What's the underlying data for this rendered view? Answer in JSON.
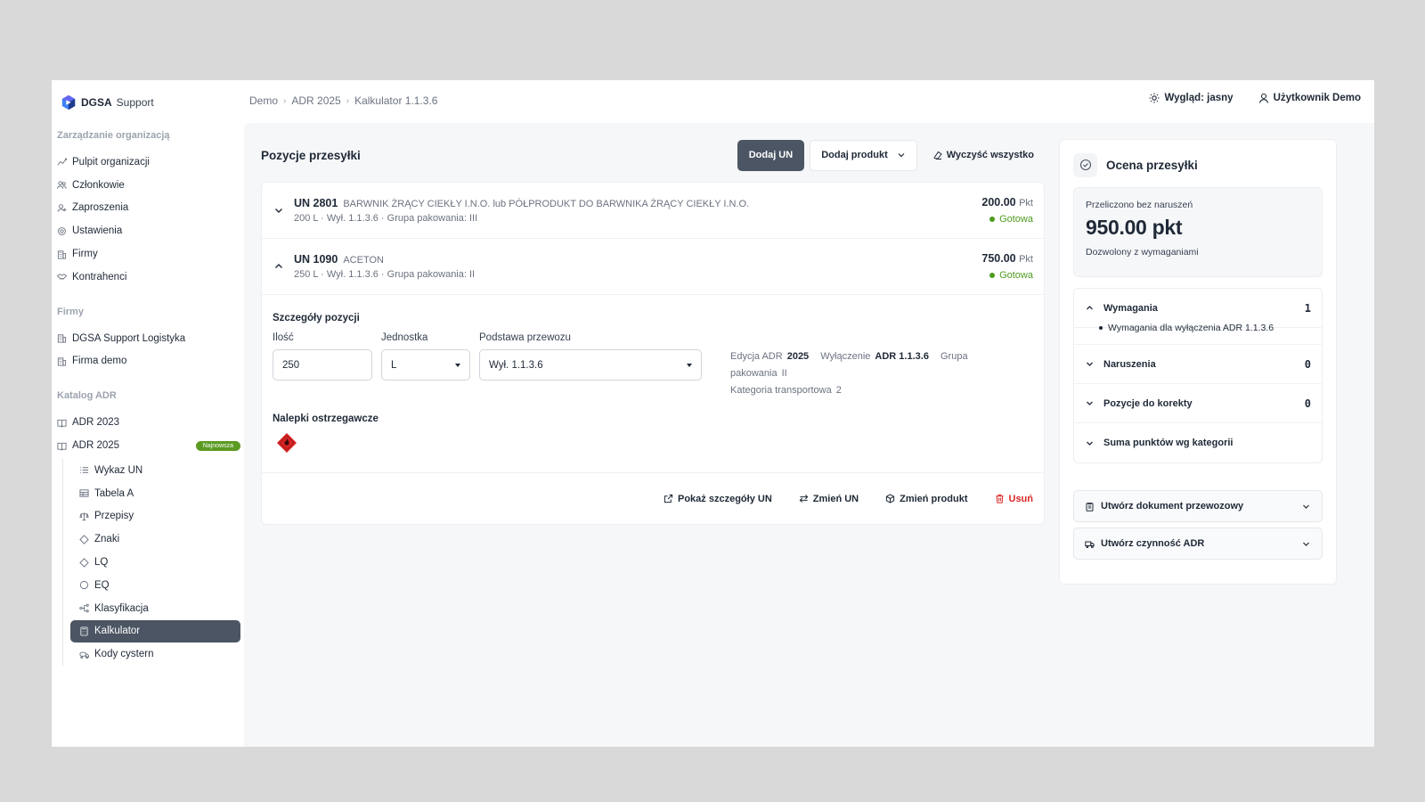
{
  "brand": {
    "name_strong": "DGSA",
    "name_light": "Support"
  },
  "breadcrumb": [
    "Demo",
    "ADR 2025",
    "Kalkulator 1.1.3.6"
  ],
  "header": {
    "theme_label": "Wygląd: jasny",
    "user_label": "Użytkownik Demo"
  },
  "sidebar": {
    "org_title": "Zarządzanie organizacją",
    "org_items": [
      "Pulpit organizacji",
      "Członkowie",
      "Zaproszenia",
      "Ustawienia",
      "Firmy",
      "Kontrahenci"
    ],
    "firms_title": "Firmy",
    "firms_items": [
      "DGSA Support Logistyka",
      "Firma demo"
    ],
    "catalog_title": "Katalog ADR",
    "catalog_items": [
      "ADR 2023",
      "ADR 2025"
    ],
    "newest_badge": "Najnowsza",
    "sub_items": [
      "Wykaz UN",
      "Tabela A",
      "Przepisy",
      "Znaki",
      "LQ",
      "EQ",
      "Klasyfikacja",
      "Kalkulator",
      "Kody cystern"
    ]
  },
  "shipment": {
    "title": "Pozycje przesyłki",
    "add_un": "Dodaj UN",
    "add_product": "Dodaj produkt",
    "clear_all": "Wyczyść wszystko",
    "items": [
      {
        "code": "UN 2801",
        "name": "BARWNIK ŻRĄCY CIEKŁY I.N.O. lub PÓŁPRODUKT DO BARWNIKA ŻRĄCY CIEKŁY I.N.O.",
        "meta": "200 L · Wył. 1.1.3.6 · Grupa pakowania: III",
        "points": "200.00",
        "points_unit": "Pkt",
        "status": "Gotowa"
      },
      {
        "code": "UN 1090",
        "name": "ACETON",
        "meta": "250 L · Wył. 1.1.3.6 · Grupa pakowania: II",
        "points": "750.00",
        "points_unit": "Pkt",
        "status": "Gotowa"
      }
    ],
    "details": {
      "title": "Szczegóły pozycji",
      "qty_label": "Ilość",
      "qty_value": "250",
      "unit_label": "Jednostka",
      "unit_value": "L",
      "basis_label": "Podstawa przewozu",
      "basis_value": "Wył. 1.1.3.6",
      "edition_label": "Edycja ADR",
      "edition_value": "2025",
      "exemption_label": "Wyłączenie",
      "exemption_value": "ADR 1.1.3.6",
      "pg_label": "Grupa pakowania",
      "pg_value": "II",
      "category_label": "Kategoria transportowa",
      "category_value": "2",
      "labels_title": "Nalepki ostrzegawcze"
    },
    "actions": {
      "show": "Pokaż szczegóły UN",
      "change_un": "Zmień UN",
      "change_product": "Zmień produkt",
      "delete": "Usuń"
    }
  },
  "assessment": {
    "title": "Ocena przesyłki",
    "score_label": "Przeliczono bez naruszeń",
    "score_value": "950.00 pkt",
    "score_sub": "Dozwolony z wymaganiami",
    "sections": [
      {
        "label": "Wymagania",
        "count": "1"
      },
      {
        "label": "Naruszenia",
        "count": "0"
      },
      {
        "label": "Pozycje do korekty",
        "count": "0"
      },
      {
        "label": "Suma punktów wg kategorii",
        "count": ""
      }
    ],
    "requirement_item": "Wymagania dla wyłączenia ADR 1.1.3.6",
    "create_doc": "Utwórz dokument przewozowy",
    "create_activity": "Utwórz czynność ADR"
  },
  "colors": {
    "accent_dark": "#4b5563",
    "ready_green": "#4d9b1e",
    "danger": "#dc2626",
    "badge_green": "#5b9b22",
    "hazard_red": "#d92323"
  }
}
